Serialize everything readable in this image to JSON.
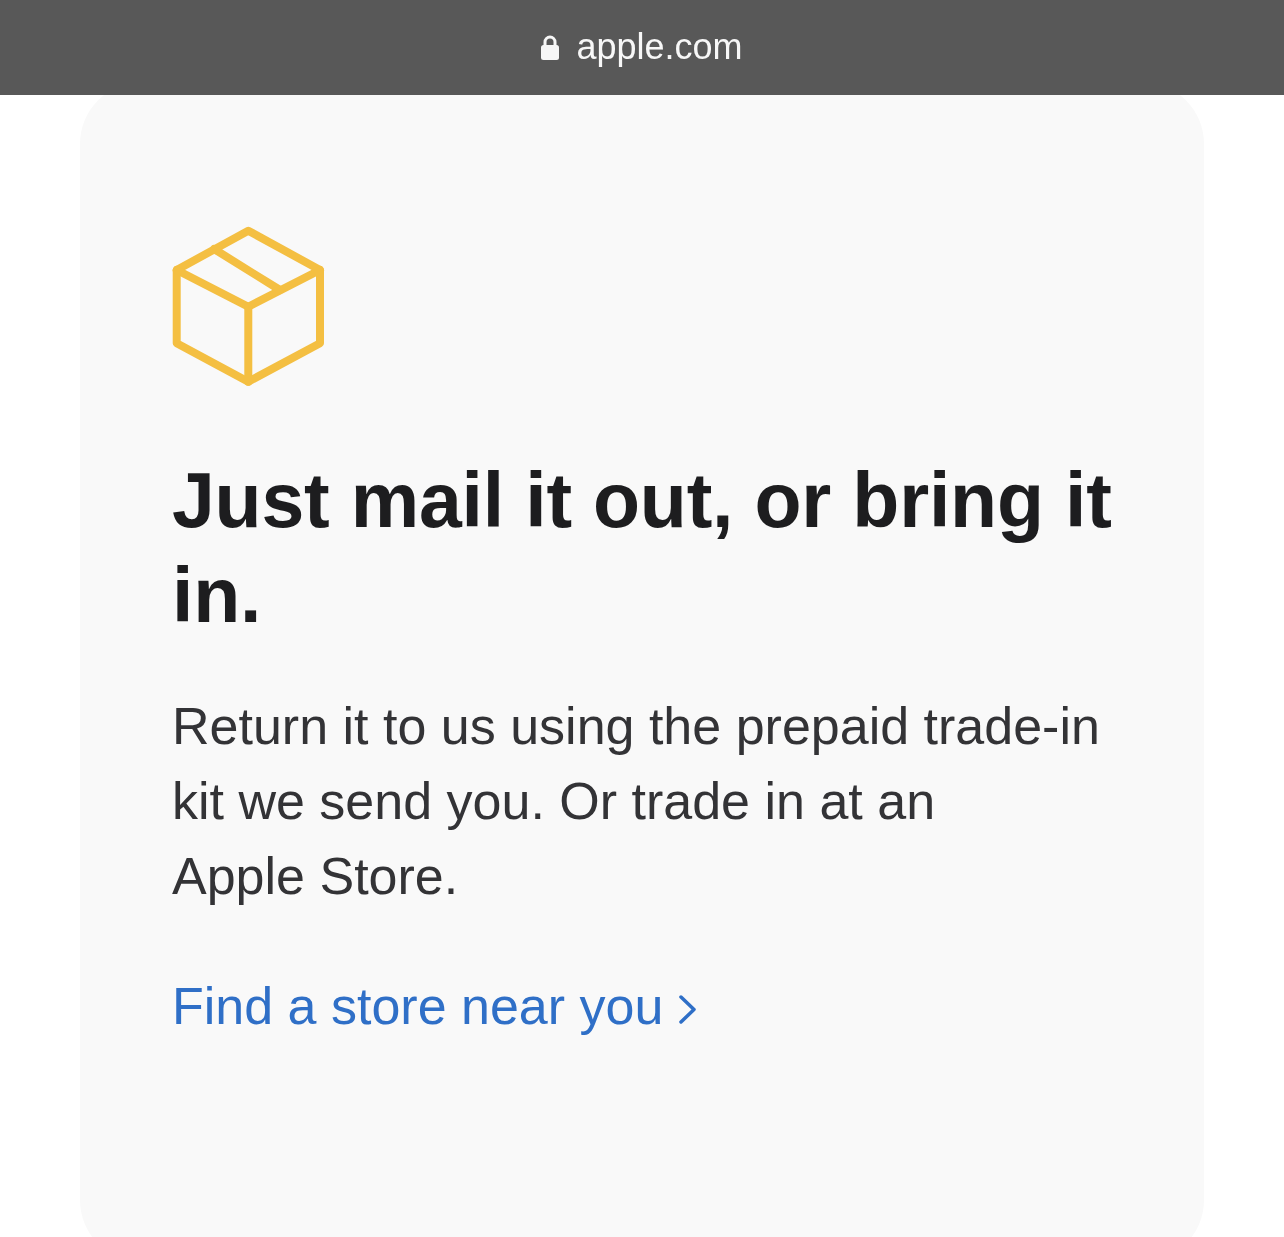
{
  "browser_bar": {
    "url": "apple.com",
    "secure": true
  },
  "card": {
    "heading": "Just mail it out, or bring it in.",
    "body": "Return it to us using the prepaid trade-in kit we send you. Or trade in at an Apple Store.",
    "link": {
      "label": "Find a store near you"
    }
  }
}
